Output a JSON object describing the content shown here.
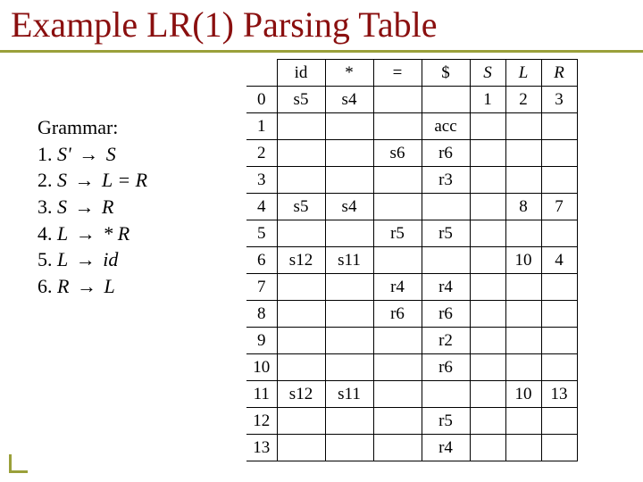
{
  "title": "Example LR(1) Parsing Table",
  "grammar": {
    "heading": "Grammar:",
    "rules": [
      {
        "n": "1.",
        "lhs": "S'",
        "rhs": "S"
      },
      {
        "n": "2.",
        "lhs": "S",
        "rhs": "L = R"
      },
      {
        "n": "3.",
        "lhs": "S",
        "rhs": "R"
      },
      {
        "n": "4.",
        "lhs": "L",
        "rhs": "* R"
      },
      {
        "n": "5.",
        "lhs": "L",
        "rhs": "id"
      },
      {
        "n": "6.",
        "lhs": "R",
        "rhs": "L"
      }
    ],
    "arrow": "→"
  },
  "chart_data": {
    "type": "table",
    "columns": [
      "id",
      "*",
      "=",
      "$",
      "S",
      "L",
      "R"
    ],
    "nonterminal_columns": [
      "S",
      "L",
      "R"
    ],
    "rows": [
      {
        "state": "0",
        "cells": [
          "s5",
          "s4",
          "",
          "",
          "1",
          "2",
          "3"
        ]
      },
      {
        "state": "1",
        "cells": [
          "",
          "",
          "",
          "acc",
          "",
          "",
          ""
        ]
      },
      {
        "state": "2",
        "cells": [
          "",
          "",
          "s6",
          "r6",
          "",
          "",
          ""
        ]
      },
      {
        "state": "3",
        "cells": [
          "",
          "",
          "",
          "r3",
          "",
          "",
          ""
        ]
      },
      {
        "state": "4",
        "cells": [
          "s5",
          "s4",
          "",
          "",
          "",
          "8",
          "7"
        ]
      },
      {
        "state": "5",
        "cells": [
          "",
          "",
          "r5",
          "r5",
          "",
          "",
          ""
        ]
      },
      {
        "state": "6",
        "cells": [
          "s12",
          "s11",
          "",
          "",
          "",
          "10",
          "4"
        ]
      },
      {
        "state": "7",
        "cells": [
          "",
          "",
          "r4",
          "r4",
          "",
          "",
          ""
        ]
      },
      {
        "state": "8",
        "cells": [
          "",
          "",
          "r6",
          "r6",
          "",
          "",
          ""
        ]
      },
      {
        "state": "9",
        "cells": [
          "",
          "",
          "",
          "r2",
          "",
          "",
          ""
        ]
      },
      {
        "state": "10",
        "cells": [
          "",
          "",
          "",
          "r6",
          "",
          "",
          ""
        ]
      },
      {
        "state": "11",
        "cells": [
          "s12",
          "s11",
          "",
          "",
          "",
          "10",
          "13"
        ]
      },
      {
        "state": "12",
        "cells": [
          "",
          "",
          "",
          "r5",
          "",
          "",
          ""
        ]
      },
      {
        "state": "13",
        "cells": [
          "",
          "",
          "",
          "r4",
          "",
          "",
          ""
        ]
      }
    ]
  }
}
